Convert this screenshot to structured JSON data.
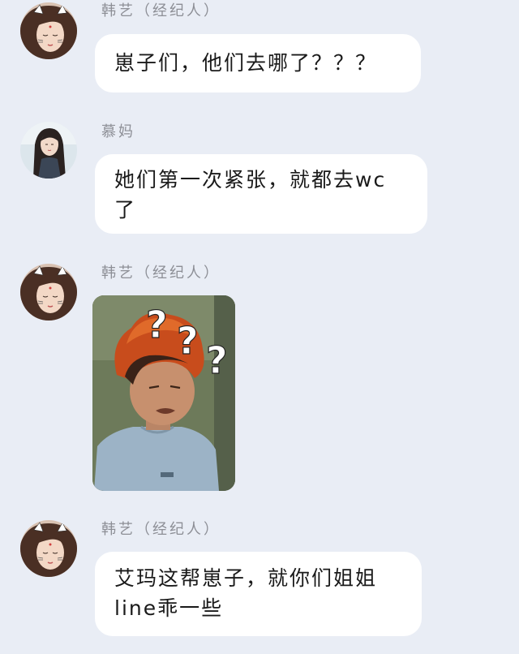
{
  "messages": [
    {
      "sender": "韩艺（经纪人）",
      "avatar_icon": "girl-cat-ears-avatar",
      "lines": [
        "崽子们，他们去哪了？？？"
      ]
    },
    {
      "sender": "慕妈",
      "avatar_icon": "girl-long-hair-avatar",
      "lines": [
        "她们第一次紧张，就都去wc",
        "了"
      ]
    },
    {
      "sender": "韩艺（经纪人）",
      "avatar_icon": "girl-cat-ears-avatar",
      "image": {
        "description_icon": "confused-boy-meme-image",
        "overlay_text": "???"
      }
    },
    {
      "sender": "韩艺（经纪人）",
      "avatar_icon": "girl-cat-ears-avatar",
      "lines": [
        "艾玛这帮崽子，就你们姐姐",
        "line乖一些"
      ]
    }
  ],
  "colors": {
    "background": "#e9edf5",
    "bubble": "#ffffff",
    "sender_text": "#8d8f96",
    "message_text": "#1a1a1a"
  }
}
